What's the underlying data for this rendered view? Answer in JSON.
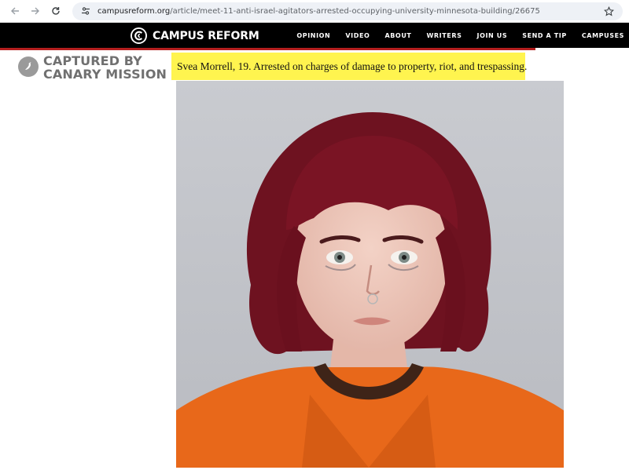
{
  "browser": {
    "url_host": "campusreform.org",
    "url_path": "/article/meet-11-anti-israel-agitators-arrested-occupying-university-minnesota-building/26675",
    "icons": [
      "back-arrow-icon",
      "forward-arrow-icon",
      "reload-icon",
      "site-settings-icon",
      "bookmark-star-icon"
    ]
  },
  "site": {
    "logo_text": "CAMPUS REFORM",
    "nav": [
      "OPINION",
      "VIDEO",
      "ABOUT",
      "WRITERS",
      "JOIN US",
      "SEND A TIP",
      "CAMPUSES"
    ],
    "accent_color": "#b41e1e"
  },
  "sidebar": {
    "canary_line1": "CAPTURED BY",
    "canary_line2": "CANARY MISSION"
  },
  "article": {
    "caption": "Svea Morrell, 19. Arrested on charges of damage to property, riot, and trespassing.",
    "highlight_color": "#fff44f"
  }
}
